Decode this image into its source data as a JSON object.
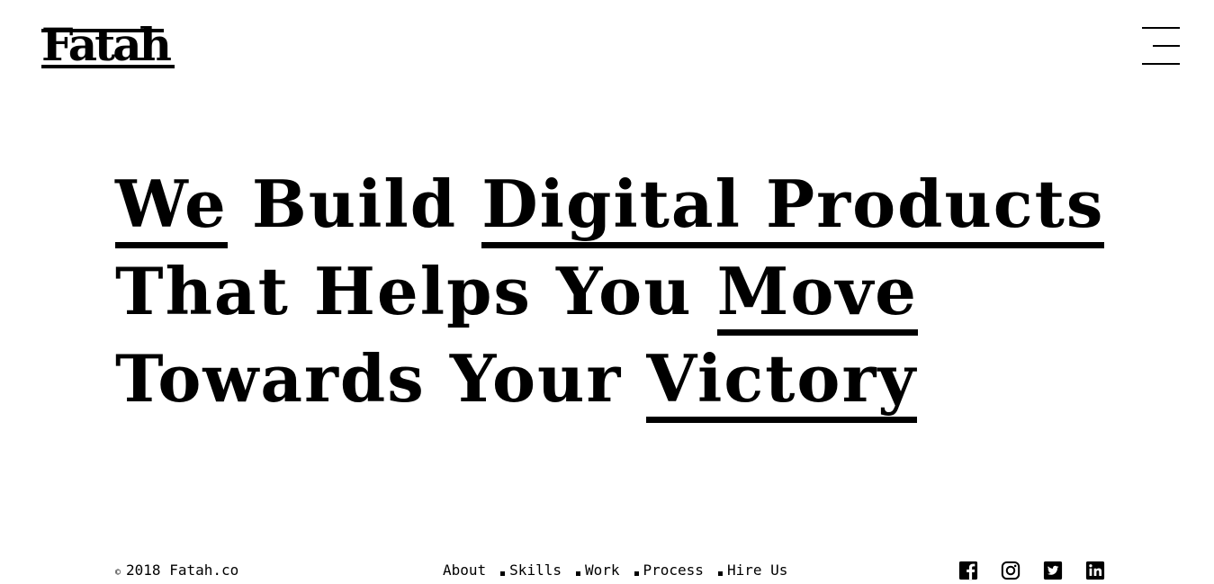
{
  "header": {
    "logo_text": "Fatah",
    "menu_icon": "hamburger-menu-icon"
  },
  "hero": {
    "lines": [
      [
        {
          "text": "We",
          "underlined": true
        },
        {
          "text": " Build ",
          "underlined": false
        },
        {
          "text": "Digital Products",
          "underlined": true
        }
      ],
      [
        {
          "text": "That Helps You ",
          "underlined": false
        },
        {
          "text": "Move",
          "underlined": true
        }
      ],
      [
        {
          "text": "Towards Your ",
          "underlined": false
        },
        {
          "text": "Victory",
          "underlined": true
        }
      ]
    ]
  },
  "footer": {
    "copyright_symbol": "©",
    "copyright_text": "2018 Fatah.co",
    "nav": [
      "About",
      "Skills",
      "Work",
      "Process",
      "Hire Us"
    ],
    "social": [
      {
        "name": "facebook-icon"
      },
      {
        "name": "instagram-icon"
      },
      {
        "name": "twitter-icon"
      },
      {
        "name": "linkedin-icon"
      }
    ]
  },
  "colors": {
    "background": "#ffffff",
    "text": "#000000"
  }
}
